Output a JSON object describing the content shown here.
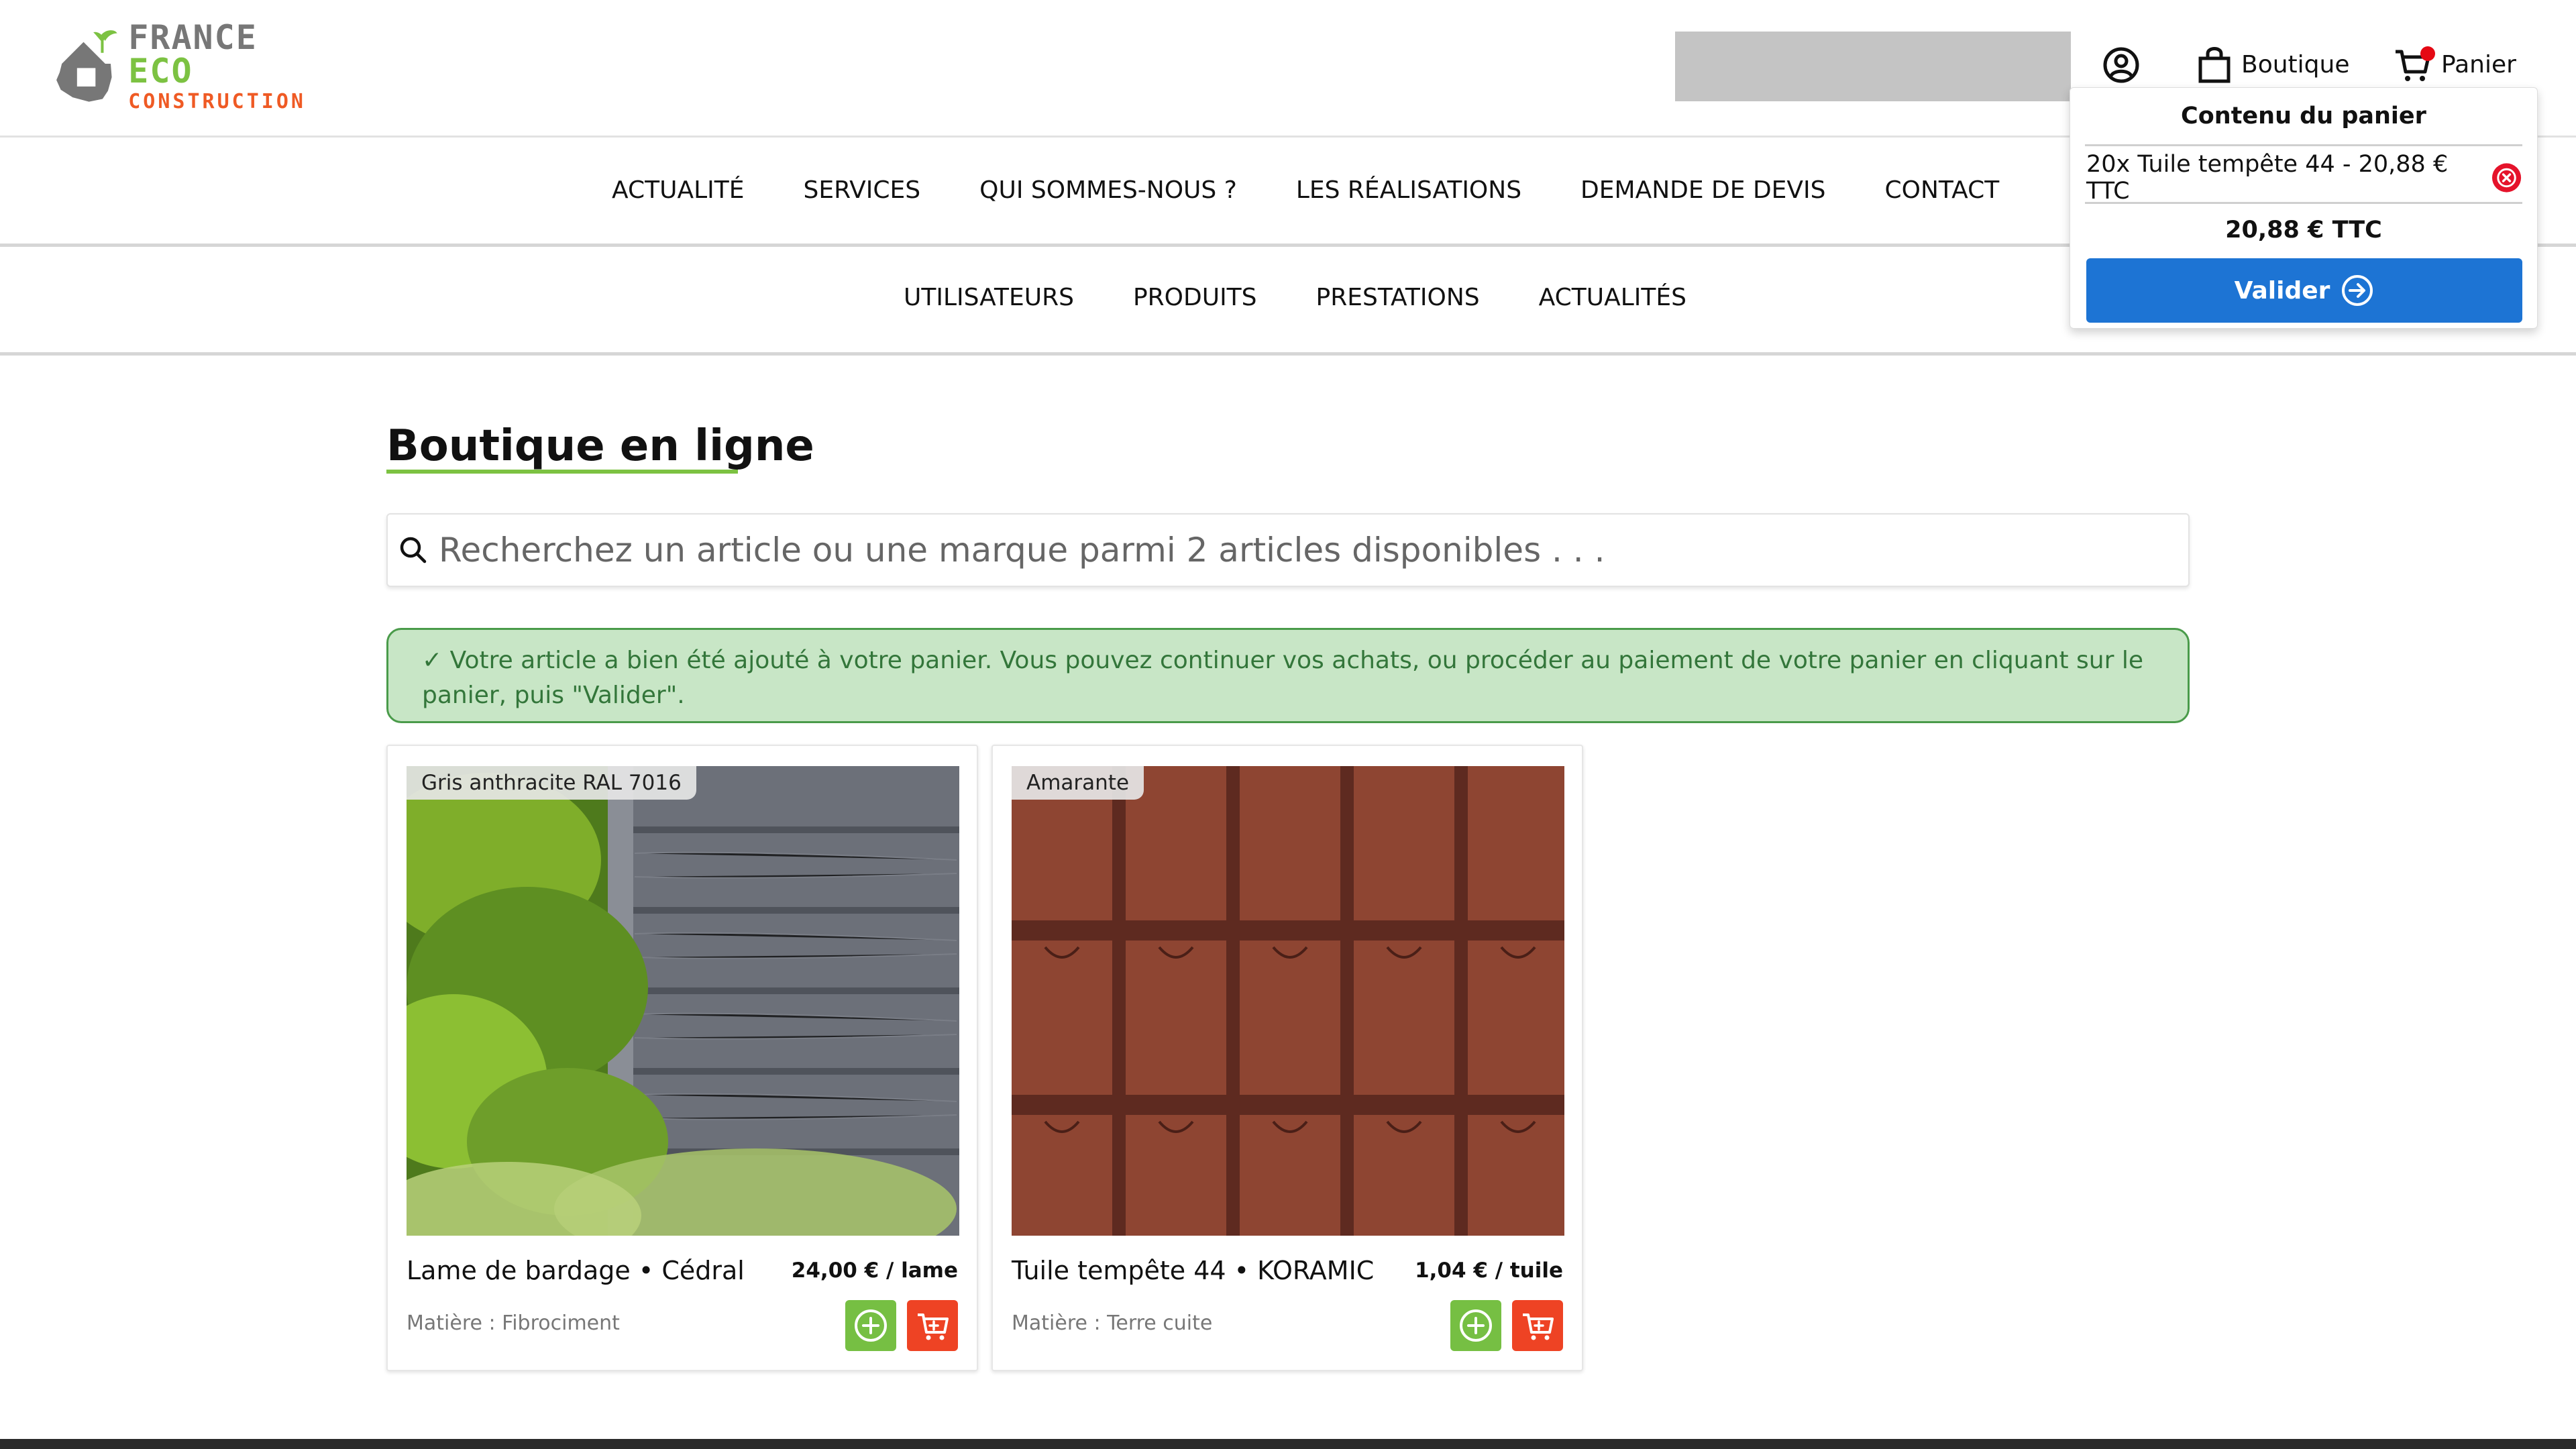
{
  "brand": {
    "line1_a": "FRANCE",
    "line1_b": "ECO",
    "line2": "CONSTRUCTION",
    "colors": {
      "gray": "#777777",
      "green": "#7cc242",
      "orange": "#ef5a24"
    }
  },
  "header": {
    "account_icon": "user-circle-icon",
    "boutique_label": "Boutique",
    "panier_label": "Panier"
  },
  "main_nav": [
    "ACTUALITÉ",
    "SERVICES",
    "QUI SOMMES-NOUS ?",
    "LES RÉALISATIONS",
    "DEMANDE DE DEVIS",
    "CONTACT"
  ],
  "sub_nav": [
    "UTILISATEURS",
    "PRODUITS",
    "PRESTATIONS",
    "ACTUALITÉS"
  ],
  "cart": {
    "title": "Contenu du panier",
    "item": "20x Tuile tempête 44 - 20,88 € TTC",
    "total": "20,88 € TTC",
    "validate_label": "Valider",
    "button_color": "#1d74d4"
  },
  "page": {
    "title": "Boutique en ligne",
    "search_placeholder": "Recherchez un article ou une marque parmi 2 articles disponibles . . .",
    "alert": "✓ Votre article a bien été ajouté à votre panier. Vous pouvez continuer vos achats, ou procéder au paiement de votre panier en cliquant sur le panier, puis \"Valider\"."
  },
  "products": [
    {
      "badge": "Gris anthracite RAL 7016",
      "name": "Lame de bardage • Cédral",
      "price": "24,00 € / lame",
      "meta": "Matière : Fibrociment"
    },
    {
      "badge": "Amarante",
      "name": "Tuile tempête 44 • KORAMIC",
      "price": "1,04 € / tuile",
      "meta": "Matière : Terre cuite"
    }
  ]
}
